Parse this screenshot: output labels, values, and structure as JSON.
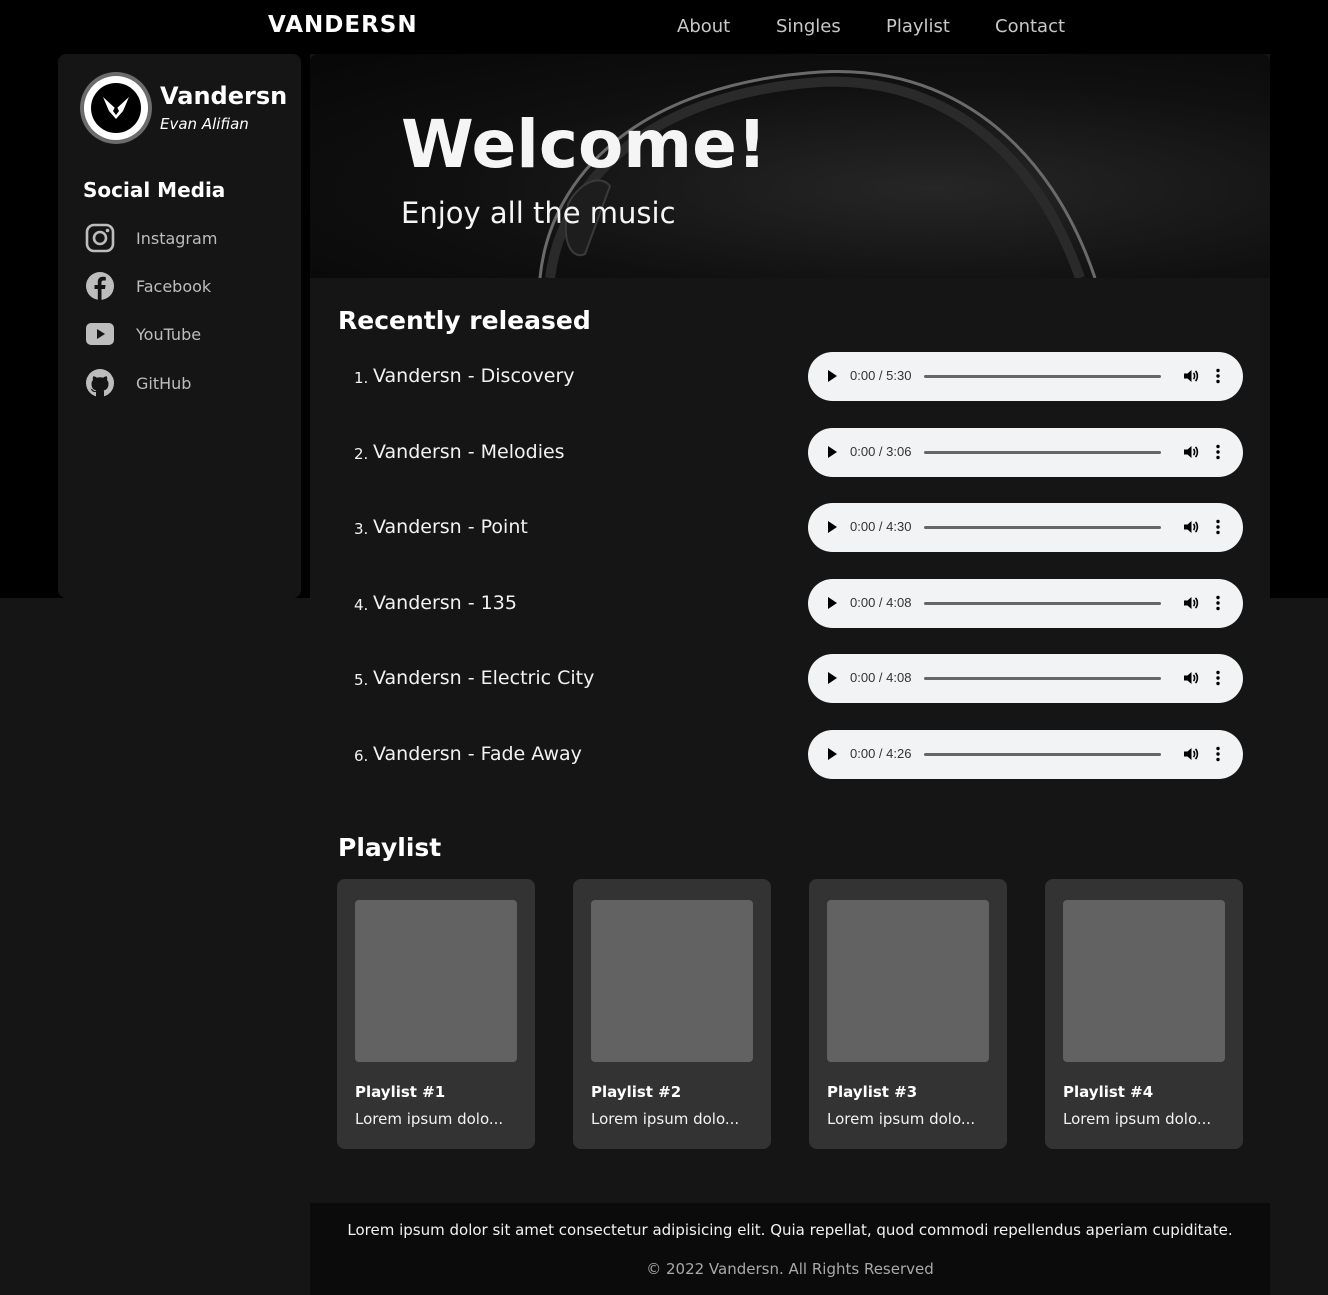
{
  "navbar": {
    "logo": "VANDERSN",
    "links": [
      "About",
      "Singles",
      "Playlist",
      "Contact"
    ]
  },
  "sidebar": {
    "artist_name": "Vandersn",
    "artist_real_name": "Evan Alifian",
    "social_title": "Social Media",
    "social_links": [
      {
        "label": "Instagram",
        "icon": "instagram-icon"
      },
      {
        "label": "Facebook",
        "icon": "facebook-icon"
      },
      {
        "label": "YouTube",
        "icon": "youtube-icon"
      },
      {
        "label": "GitHub",
        "icon": "github-icon"
      }
    ]
  },
  "hero": {
    "title": "Welcome!",
    "subtitle": "Enjoy all the music"
  },
  "recent": {
    "title": "Recently released",
    "tracks": [
      {
        "num": "1.",
        "title": "Vandersn - Discovery",
        "time": "0:00 / 5:30"
      },
      {
        "num": "2.",
        "title": "Vandersn - Melodies",
        "time": "0:00 / 3:06"
      },
      {
        "num": "3.",
        "title": "Vandersn - Point",
        "time": "0:00 / 4:30"
      },
      {
        "num": "4.",
        "title": "Vandersn - 135",
        "time": "0:00 / 4:08"
      },
      {
        "num": "5.",
        "title": "Vandersn - Electric City",
        "time": "0:00 / 4:08"
      },
      {
        "num": "6.",
        "title": "Vandersn - Fade Away",
        "time": "0:00 / 4:26"
      }
    ]
  },
  "playlist": {
    "title": "Playlist",
    "cards": [
      {
        "title": "Playlist #1",
        "desc": "Lorem ipsum dolo..."
      },
      {
        "title": "Playlist #2",
        "desc": "Lorem ipsum dolo..."
      },
      {
        "title": "Playlist #3",
        "desc": "Lorem ipsum dolo..."
      },
      {
        "title": "Playlist #4",
        "desc": "Lorem ipsum dolo..."
      }
    ]
  },
  "footer": {
    "text": "Lorem ipsum dolor sit amet consectetur adipisicing elit. Quia repellat, quod commodi repellendus aperiam cupiditate.",
    "copyright": "© 2022 Vandersn. All Rights Reserved"
  },
  "colors": {
    "background": "#151515",
    "top_band": "#000000",
    "card": "#333333",
    "player": "#f1f3f4"
  }
}
